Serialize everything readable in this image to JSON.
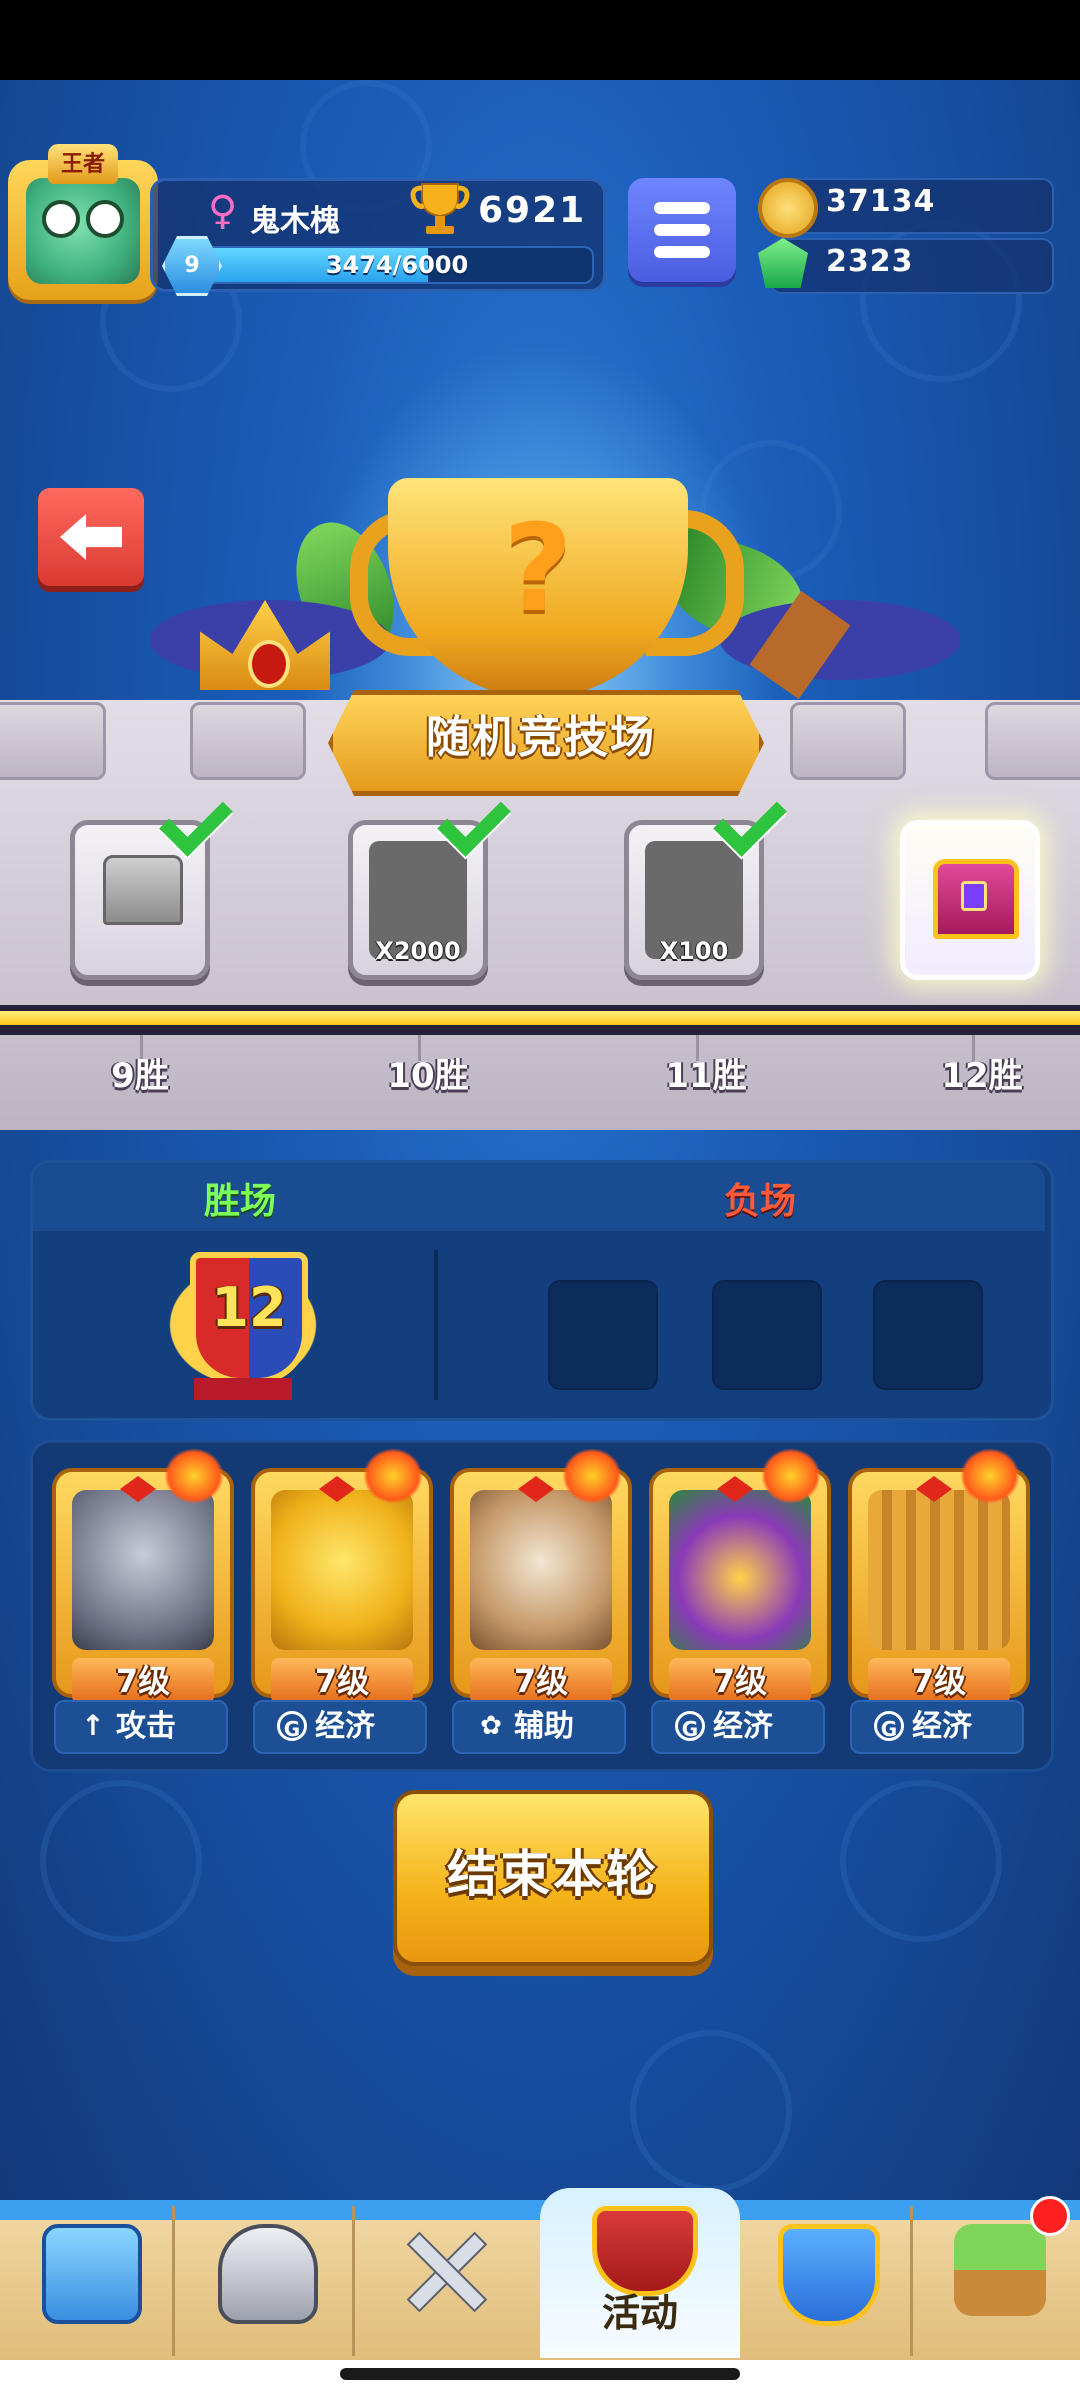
{
  "player": {
    "rank_badge": "王者",
    "name": "鬼木槐",
    "trophies": "6921",
    "level": "9",
    "xp_text": "3474/6000",
    "xp_progress": 0.579
  },
  "currency": {
    "coins": "37134",
    "gems": "2323"
  },
  "icons": {
    "gender": "female-icon",
    "trophy": "trophy-icon",
    "menu": "hamburger-menu-icon",
    "coin": "coin-icon",
    "gem": "green-gem-icon",
    "back": "back-arrow-icon"
  },
  "arena": {
    "title": "随机竞技场",
    "rewards": [
      {
        "wins_label": "9胜",
        "quantity": "",
        "claimed": true,
        "icon": "silver-chest-icon"
      },
      {
        "wins_label": "10胜",
        "quantity": "X2000",
        "claimed": true,
        "icon": "coin-pile-icon"
      },
      {
        "wins_label": "11胜",
        "quantity": "X100",
        "claimed": true,
        "icon": "silver-pile-icon"
      },
      {
        "wins_label": "12胜",
        "quantity": "",
        "claimed": false,
        "icon": "gold-chest-icon"
      }
    ],
    "progress": 1.0
  },
  "record": {
    "wins_label": "胜场",
    "losses_label": "负场",
    "wins": "12",
    "loss_slots": 3
  },
  "heroes": [
    {
      "level": "7级",
      "role": "攻击",
      "role_icon": "sword-icon",
      "art": "knight-hero"
    },
    {
      "level": "7级",
      "role": "经济",
      "role_icon": "coin-g-icon",
      "art": "chef-hero"
    },
    {
      "level": "7级",
      "role": "辅助",
      "role_icon": "sprout-icon",
      "art": "bull-elder-hero"
    },
    {
      "level": "7级",
      "role": "经济",
      "role_icon": "coin-g-icon",
      "art": "bandit-hero"
    },
    {
      "level": "7级",
      "role": "经济",
      "role_icon": "coin-g-icon",
      "art": "wood-golem-hero"
    }
  ],
  "actions": {
    "end_round": "结束本轮"
  },
  "nav": {
    "items": [
      {
        "name": "shop",
        "icon": "treasure-chest-icon"
      },
      {
        "name": "heroes",
        "icon": "knight-helmet-icon"
      },
      {
        "name": "battle",
        "icon": "crossed-swords-icon"
      },
      {
        "name": "events",
        "icon": "crown-shield-icon",
        "label": "活动",
        "active": true
      },
      {
        "name": "social",
        "icon": "friends-shield-icon"
      },
      {
        "name": "garden",
        "icon": "sprout-island-icon",
        "notification": true
      }
    ]
  },
  "colors": {
    "background": "#1a5cb8",
    "accent_gold": "#f5b21a",
    "win_green": "#7dff5a",
    "loss_red": "#ff5a3a"
  }
}
